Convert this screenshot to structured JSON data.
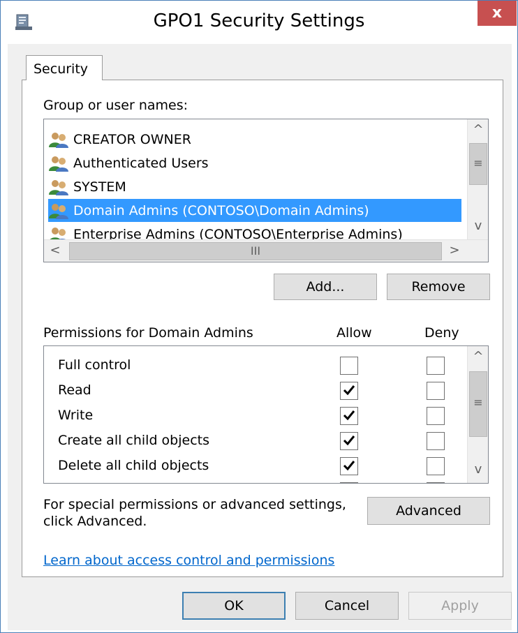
{
  "window": {
    "title": "GPO1 Security Settings",
    "close_glyph": "x"
  },
  "tab": {
    "label": "Security"
  },
  "groups": {
    "label": "Group or user names:",
    "items": [
      {
        "label": "CREATOR OWNER",
        "selected": false
      },
      {
        "label": "Authenticated Users",
        "selected": false
      },
      {
        "label": "SYSTEM",
        "selected": false
      },
      {
        "label": "Domain Admins (CONTOSO\\Domain Admins)",
        "selected": true
      },
      {
        "label": "Enterprise Admins (CONTOSO\\Enterprise Admins)",
        "selected": false
      }
    ],
    "add_label": "Add...",
    "remove_label": "Remove"
  },
  "permissions": {
    "label": "Permissions for Domain Admins",
    "allow_header": "Allow",
    "deny_header": "Deny",
    "items": [
      {
        "name": "Full control",
        "allow": false,
        "deny": false
      },
      {
        "name": "Read",
        "allow": true,
        "deny": false
      },
      {
        "name": "Write",
        "allow": true,
        "deny": false
      },
      {
        "name": "Create all child objects",
        "allow": true,
        "deny": false
      },
      {
        "name": "Delete all child objects",
        "allow": true,
        "deny": false
      }
    ]
  },
  "advanced": {
    "text_line1": "For special permissions or advanced settings,",
    "text_line2": "click Advanced.",
    "button_label": "Advanced"
  },
  "help_link": "Learn about access control and permissions",
  "footer": {
    "ok_label": "OK",
    "cancel_label": "Cancel",
    "apply_label": "Apply"
  },
  "scrollbar": {
    "up": "^",
    "down": "v",
    "left": "<",
    "right": ">",
    "grip_v": "≡",
    "grip_h": "III"
  },
  "colors": {
    "selection": "#3399ff",
    "close_button": "#c75050",
    "link": "#0066cc"
  },
  "icons": {
    "app": "security-settings-icon",
    "user": "user-group-icon",
    "check": "checkmark-icon"
  }
}
